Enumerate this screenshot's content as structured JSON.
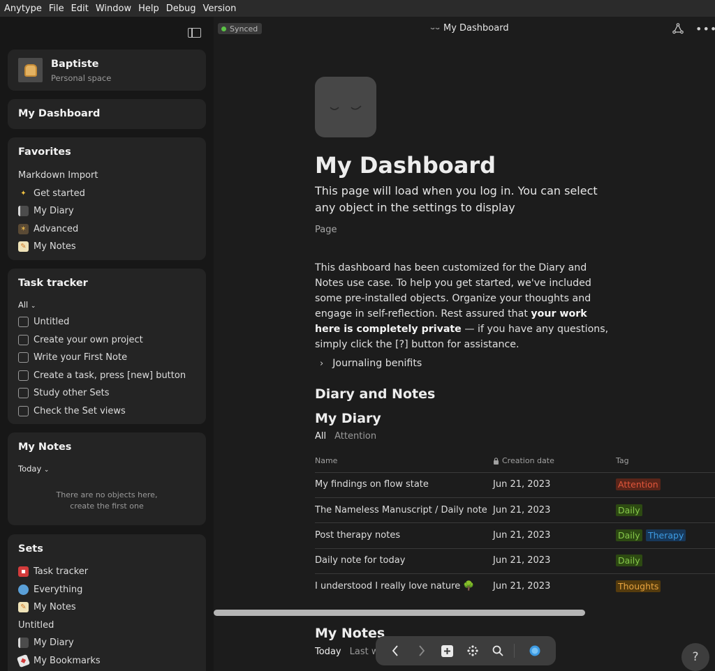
{
  "menubar": [
    "Anytype",
    "File",
    "Edit",
    "Window",
    "Help",
    "Debug",
    "Version"
  ],
  "space": {
    "name": "Baptiste",
    "type": "Personal space"
  },
  "sidebar": {
    "dashboard_label": "My Dashboard",
    "favorites": {
      "title": "Favorites",
      "items": [
        {
          "label": "Markdown Import",
          "icon": ""
        },
        {
          "label": "Get started",
          "icon": "sparkle-icon"
        },
        {
          "label": "My Diary",
          "icon": "notebook-icon"
        },
        {
          "label": "Advanced",
          "icon": "clapper-icon"
        },
        {
          "label": "My Notes",
          "icon": "memo-icon"
        }
      ]
    },
    "task_tracker": {
      "title": "Task tracker",
      "filter": "All",
      "items": [
        "Untitled",
        "Create your own project",
        "Write your First Note",
        "Create a task, press [new] button",
        "Study other Sets",
        "Check the Set views"
      ]
    },
    "my_notes": {
      "title": "My Notes",
      "filter": "Today",
      "empty_line1": "There are no objects here,",
      "empty_line2": "create the first one"
    },
    "sets": {
      "title": "Sets",
      "items": [
        {
          "label": "Task tracker",
          "icon": "mailbox-icon"
        },
        {
          "label": "Everything",
          "icon": "globe-icon"
        },
        {
          "label": "My Notes",
          "icon": "memo-icon"
        },
        {
          "label": "Untitled",
          "icon": ""
        },
        {
          "label": "My Diary",
          "icon": "notebook-icon"
        },
        {
          "label": "My Bookmarks",
          "icon": "bookmark-icon"
        }
      ]
    }
  },
  "topbar": {
    "status": "Synced",
    "title": "My Dashboard"
  },
  "page": {
    "title": "My Dashboard",
    "description": "This page will load when you log in. You can select any object in the settings to display",
    "type": "Page",
    "intro_1": "This dashboard has been customized for the Diary and Notes use case. To help you get started, we've included some pre-installed objects. Organize your thoughts and engage in self-reflection. Rest assured that ",
    "intro_bold": "your work here is completely private",
    "intro_2": " — if you have any questions, simply click the [?] button for assistance.",
    "toggle": "Journaling benifits",
    "section_heading": "Diary and Notes",
    "diary_heading": "My Diary",
    "diary_tabs": [
      "All",
      "Attention"
    ],
    "notes_heading": "My Notes",
    "notes_tabs": [
      "Today",
      "Last w"
    ]
  },
  "table": {
    "columns": [
      "Name",
      "Creation date",
      "Tag"
    ],
    "rows": [
      {
        "name": "My findings on flow state",
        "date": "Jun 21, 2023",
        "tags": [
          "Attention"
        ]
      },
      {
        "name": "The Nameless Manuscript / Daily note",
        "date": "Jun 21, 2023",
        "tags": [
          "Daily"
        ]
      },
      {
        "name": "Post therapy notes",
        "date": "Jun 21, 2023",
        "tags": [
          "Daily",
          "Therapy"
        ]
      },
      {
        "name": "Daily note for today",
        "date": "Jun 21, 2023",
        "tags": [
          "Daily"
        ]
      },
      {
        "name": "I understood I really love nature 🌳",
        "date": "Jun 21, 2023",
        "tags": [
          "Thoughts"
        ]
      }
    ]
  },
  "tag_colors": {
    "Attention": {
      "bg": "#5a2519",
      "fg": "#e2563b"
    },
    "Daily": {
      "bg": "#2d4a12",
      "fg": "#86c84a"
    },
    "Therapy": {
      "bg": "#17385a",
      "fg": "#3d9be3"
    },
    "Thoughts": {
      "bg": "#553b0d",
      "fg": "#e9a43f"
    }
  },
  "help": "?"
}
